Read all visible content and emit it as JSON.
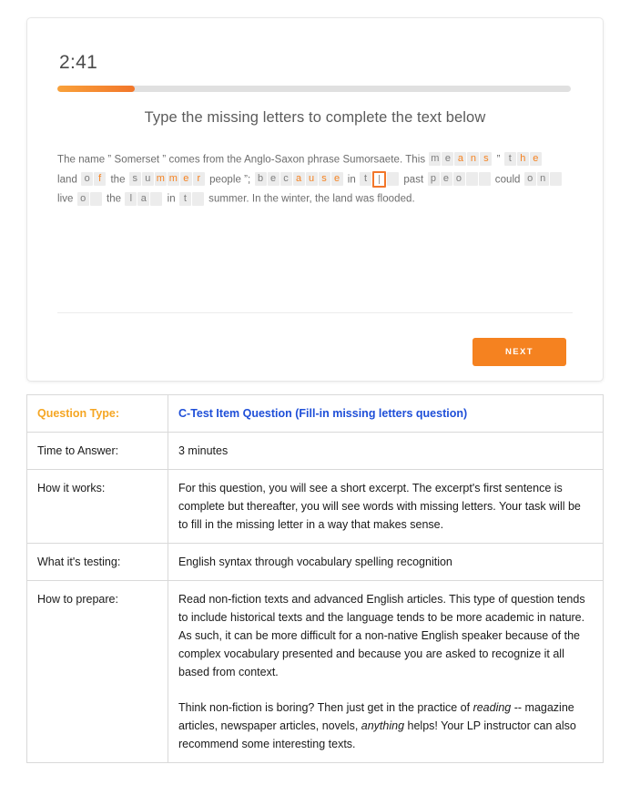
{
  "quiz": {
    "timer": "2:41",
    "progress_percent": 15,
    "progress_fill_color": "#f58220",
    "progress_track_color": "#e0e0e0",
    "prompt": "Type the missing letters to complete the text below",
    "next_label": "NEXT",
    "next_button_color": "#f58220",
    "passage_segments": [
      {
        "kind": "text",
        "text": "The name ” Somerset ” comes from the Anglo-Saxon phrase Sumorsaete. This"
      },
      {
        "kind": "word",
        "given": "me",
        "filled": "ans",
        "blanks": 0
      },
      {
        "kind": "text",
        "text": "”"
      },
      {
        "kind": "word",
        "given": "t",
        "filled": "he",
        "blanks": 0
      },
      {
        "kind": "text",
        "text": "land"
      },
      {
        "kind": "word",
        "given": "o",
        "filled": "f",
        "blanks": 0
      },
      {
        "kind": "text",
        "text": "the"
      },
      {
        "kind": "word",
        "given": "su",
        "filled": "mmer",
        "blanks": 0
      },
      {
        "kind": "text",
        "text": "people ”;"
      },
      {
        "kind": "word",
        "given": "bec",
        "filled": "ause",
        "blanks": 0
      },
      {
        "kind": "text",
        "text": "in"
      },
      {
        "kind": "word",
        "given": "t",
        "filled": "",
        "blanks": 1,
        "active": true,
        "trailing_blanks": 1
      },
      {
        "kind": "text",
        "text": "past"
      },
      {
        "kind": "word",
        "given": "peo",
        "filled": "",
        "blanks": 2
      },
      {
        "kind": "text",
        "text": "could"
      },
      {
        "kind": "word",
        "given": "on",
        "filled": "",
        "blanks": 1
      },
      {
        "kind": "text",
        "text": "live"
      },
      {
        "kind": "word",
        "given": "o",
        "filled": "",
        "blanks": 1
      },
      {
        "kind": "text",
        "text": "the"
      },
      {
        "kind": "word",
        "given": "la",
        "filled": "",
        "blanks": 1
      },
      {
        "kind": "text",
        "text": "in"
      },
      {
        "kind": "word",
        "given": "t",
        "filled": "",
        "blanks": 1
      },
      {
        "kind": "text",
        "text": "summer. In the winter, the land was flooded."
      }
    ]
  },
  "info_table": {
    "rows": [
      {
        "label": "Question Type:",
        "label_accent": true,
        "value_accent": true,
        "paragraphs": [
          {
            "runs": [
              {
                "text": "C-Test Item Question (Fill-in missing letters question)"
              }
            ]
          }
        ]
      },
      {
        "label": "Time to Answer:",
        "label_accent": false,
        "value_accent": false,
        "paragraphs": [
          {
            "runs": [
              {
                "text": "3 minutes"
              }
            ]
          }
        ]
      },
      {
        "label": "How it works:",
        "label_accent": false,
        "value_accent": false,
        "paragraphs": [
          {
            "runs": [
              {
                "text": "For this question, you will see a short excerpt. The excerpt's first sentence is complete but thereafter, you will see words with missing letters. Your task will be to fill in the missing letter in a way that makes sense."
              }
            ]
          }
        ]
      },
      {
        "label": "What it's testing:",
        "label_accent": false,
        "value_accent": false,
        "paragraphs": [
          {
            "runs": [
              {
                "text": "English syntax through vocabulary spelling recognition"
              }
            ]
          }
        ]
      },
      {
        "label": "How to prepare:",
        "label_accent": false,
        "value_accent": false,
        "paragraphs": [
          {
            "runs": [
              {
                "text": "Read non-fiction texts and advanced English articles. This type of question tends to include historical texts and the language tends to be more academic in nature. As such, it can be more difficult for a non-native English speaker because of the complex vocabulary presented and because you are asked to recognize it all based from context."
              }
            ]
          },
          {
            "runs": [
              {
                "text": "Think non-fiction is boring?  Then just get in the practice of "
              },
              {
                "text": "reading",
                "italic": true
              },
              {
                "text": " -- magazine articles, newspaper articles, novels, "
              },
              {
                "text": "anything",
                "italic": true
              },
              {
                "text": " helps!  Your LP instructor can also recommend some interesting texts."
              }
            ]
          }
        ]
      }
    ]
  },
  "colors": {
    "accent_orange": "#f58220",
    "label_orange": "#f5a623",
    "link_blue": "#1f4fd8",
    "cell_bg": "#ececec",
    "given_letter": "#7d7d7d"
  }
}
